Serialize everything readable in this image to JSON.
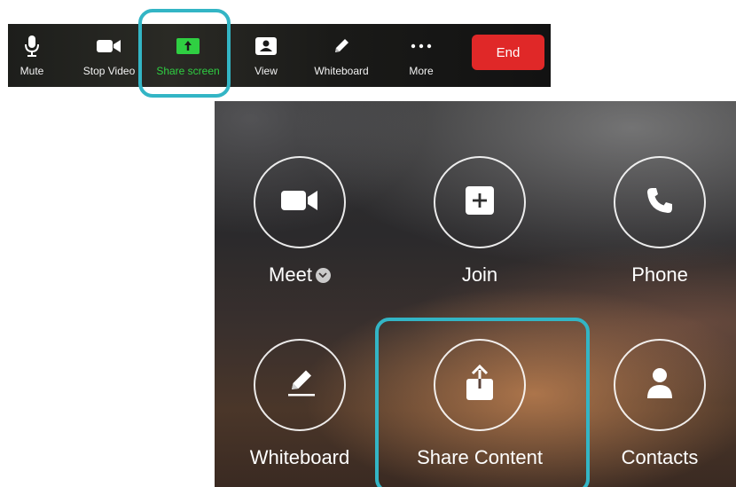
{
  "toolbar": {
    "items": [
      {
        "label": "Mute",
        "icon": "microphone-icon"
      },
      {
        "label": "Stop Video",
        "icon": "video-camera-icon"
      },
      {
        "label": "Share screen",
        "icon": "share-screen-icon"
      },
      {
        "label": "View",
        "icon": "view-icon"
      },
      {
        "label": "Whiteboard",
        "icon": "pencil-icon"
      },
      {
        "label": "More",
        "icon": "more-dots-icon"
      }
    ],
    "end_label": "End",
    "colors": {
      "share_green": "#2fcf42",
      "end_red": "#e02828",
      "highlight": "#33b5c5"
    }
  },
  "home": {
    "tiles": [
      {
        "label": "Meet",
        "icon": "video-camera-icon",
        "has_dropdown": true
      },
      {
        "label": "Join",
        "icon": "plus-icon"
      },
      {
        "label": "Phone",
        "icon": "phone-icon"
      },
      {
        "label": "Whiteboard",
        "icon": "pencil-icon"
      },
      {
        "label": "Share Content",
        "icon": "share-upload-icon"
      },
      {
        "label": "Contacts",
        "icon": "person-icon"
      }
    ]
  }
}
